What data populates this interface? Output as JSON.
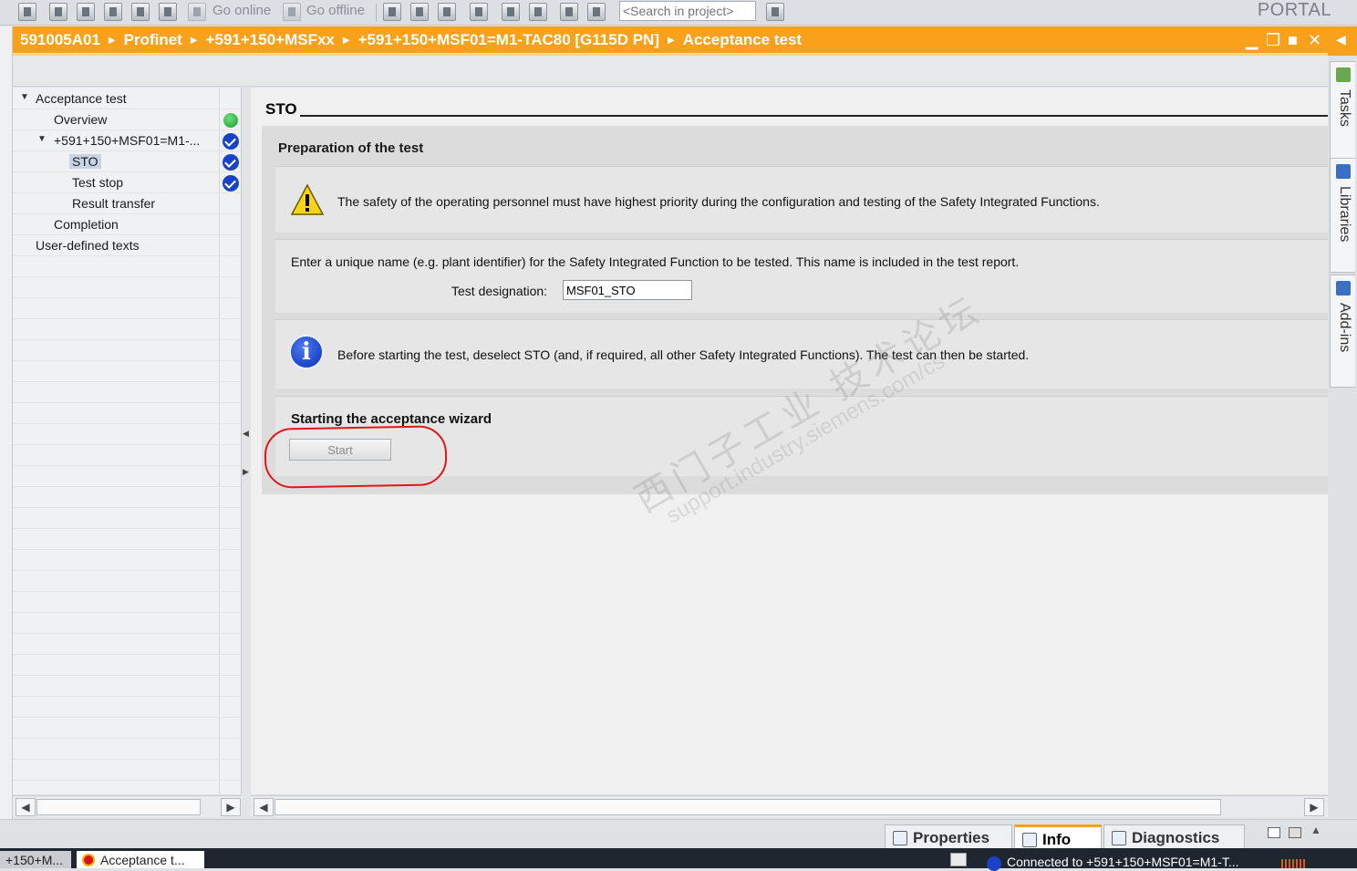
{
  "toolbar": {
    "go_online": "Go online",
    "go_offline": "Go offline",
    "search_placeholder": "<Search in project>",
    "portal": "PORTAL"
  },
  "breadcrumb": [
    "591005A01",
    "Profinet",
    "+591+150+MSFxx",
    "+591+150+MSF01=M1-TAC80 [G115D PN]",
    "Acceptance test"
  ],
  "window_controls": {
    "minimize": "▁",
    "float": "❐",
    "maximize": "■",
    "close": "✕"
  },
  "side_tabs": [
    "Tasks",
    "Libraries",
    "Add-ins"
  ],
  "tree": {
    "items": [
      {
        "label": "Acceptance test",
        "status": "none"
      },
      {
        "label": "Overview",
        "status": "green"
      },
      {
        "label": "+591+150+MSF01=M1-...",
        "status": "check"
      },
      {
        "label": "STO",
        "status": "check"
      },
      {
        "label": "Test stop",
        "status": "check"
      },
      {
        "label": "Result transfer",
        "status": "none"
      },
      {
        "label": "Completion",
        "status": "none"
      },
      {
        "label": "User-defined texts",
        "status": "none"
      }
    ]
  },
  "main": {
    "title": "STO",
    "prep_title": "Preparation of the test",
    "warning_text": "The safety of the operating personnel must have highest priority during the configuration and testing of the Safety Integrated Functions.",
    "name_instruction": "Enter a unique name (e.g. plant identifier) for the Safety Integrated Function to be tested. This name is included in the test report.",
    "designation_label": "Test designation:",
    "designation_value": "MSF01_STO",
    "info_text": "Before starting the test, deselect STO (and, if required, all other Safety Integrated Functions). The test can then be started.",
    "wizard_title": "Starting the acceptance wizard",
    "start_label": "Start"
  },
  "watermark": {
    "cn": "西门子工业 技术论坛",
    "url": "support.industry.siemens.com/cs"
  },
  "bottom_tabs": {
    "properties": "Properties",
    "info": "Info",
    "diagnostics": "Diagnostics"
  },
  "taskbar": {
    "task1": "+150+M...",
    "task2": "Acceptance t...",
    "connected": "Connected to +591+150+MSF01=M1-T..."
  },
  "colors": {
    "accent": "#f9a11b",
    "check": "#1942c6",
    "ok": "#1d9b2e",
    "highlight_ring": "#e01818"
  }
}
